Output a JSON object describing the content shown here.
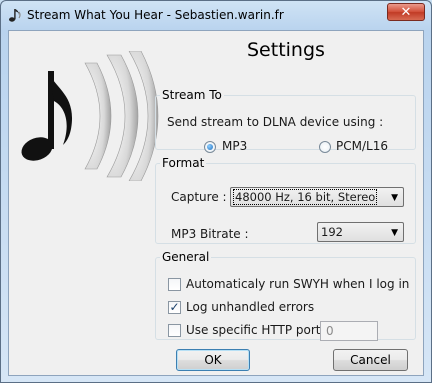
{
  "window": {
    "title": "Stream What You Hear - Sebastien.warin.fr",
    "close_label": "✕"
  },
  "page_title": "Settings",
  "stream_to": {
    "legend": "Stream To",
    "prompt": "Send stream to DLNA device using :",
    "options": [
      {
        "label": "MP3",
        "selected": true
      },
      {
        "label": "PCM/L16",
        "selected": false
      }
    ]
  },
  "format": {
    "legend": "Format",
    "capture_label": "Capture :",
    "capture_value": "48000 Hz, 16 bit, Stereo",
    "bitrate_label": "MP3 Bitrate :",
    "bitrate_value": "192"
  },
  "general": {
    "legend": "General",
    "autorun_label": "Automaticaly run SWYH when I log in",
    "autorun_checked": false,
    "log_errors_label": "Log unhandled errors",
    "log_errors_checked": true,
    "http_port_label": "Use specific HTTP port :",
    "http_port_checked": false,
    "http_port_value": "0"
  },
  "buttons": {
    "ok": "OK",
    "cancel": "Cancel"
  },
  "icons": {
    "app": "music-note-icon",
    "logo": "music-note-sound-waves-logo"
  }
}
